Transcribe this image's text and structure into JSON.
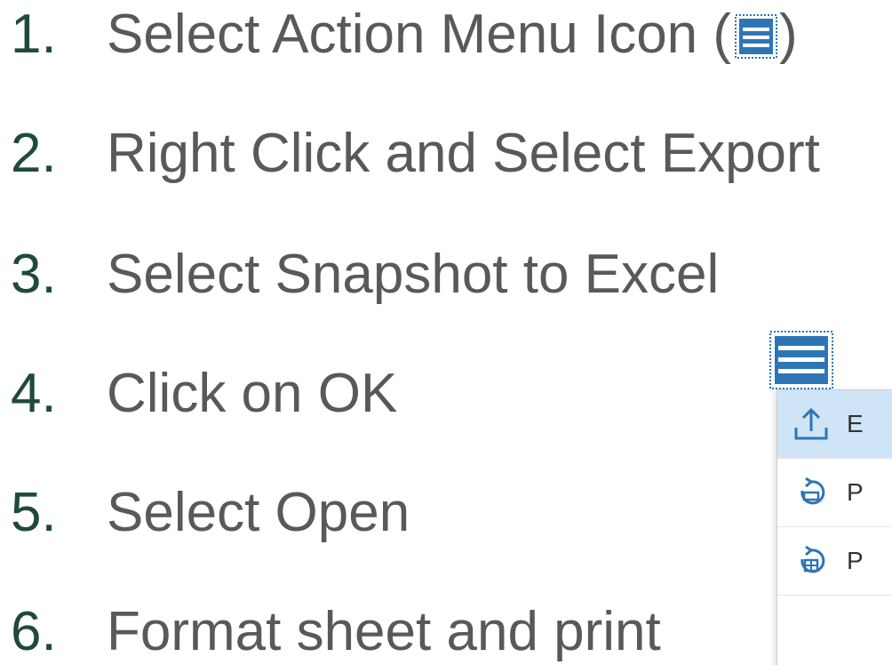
{
  "steps": [
    {
      "number": "1.",
      "text_before": "Select Action Menu Icon (",
      "text_after": ")"
    },
    {
      "number": "2.",
      "text": "Right Click and Select Export"
    },
    {
      "number": "3.",
      "text": "Select Snapshot to Excel"
    },
    {
      "number": "4.",
      "text": "Click on OK"
    },
    {
      "number": "5.",
      "text": "Select Open"
    },
    {
      "number": "6.",
      "text": "Format sheet and print"
    }
  ],
  "menu": {
    "items": [
      {
        "label": "E",
        "icon": "export-upload-icon",
        "highlighted": true
      },
      {
        "label": "P",
        "icon": "print-rotate-icon",
        "highlighted": false
      },
      {
        "label": "P",
        "icon": "print-grid-icon",
        "highlighted": false
      }
    ]
  },
  "colors": {
    "number": "#1f4a3a",
    "text": "#595959",
    "icon_blue": "#2e75b6",
    "menu_highlight": "#cfe5f7"
  }
}
